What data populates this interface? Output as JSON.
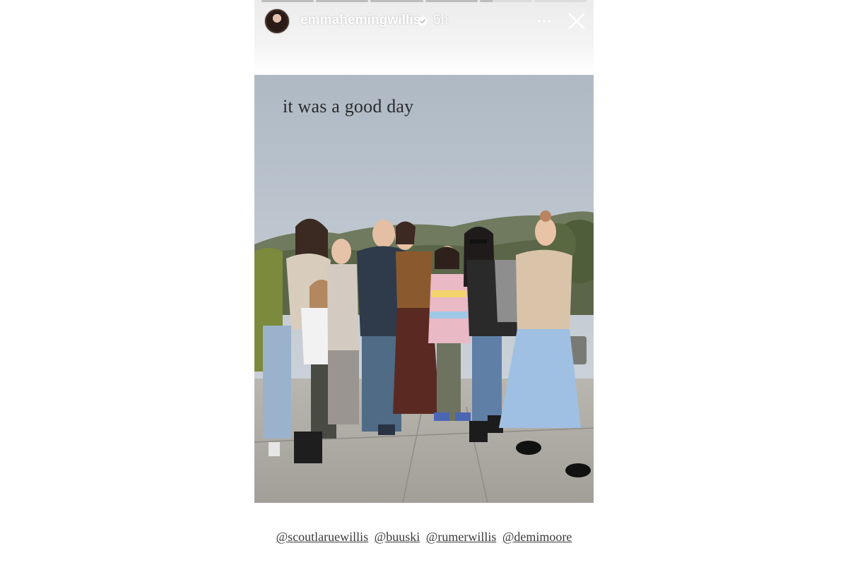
{
  "story": {
    "username": "emmahemingwillis",
    "time_ago": "5h",
    "verified_icon": "verified-badge-icon",
    "more_icon": "more-horizontal-icon",
    "close_icon": "close-icon",
    "segments_total": 6,
    "segment_active_index": 4,
    "segment_active_progress": 0.25
  },
  "photo": {
    "caption": "it was a good day"
  },
  "mentions": [
    "@scoutlaruewillis",
    "@buuski",
    "@rumerwillis",
    "@demimoore"
  ],
  "colors": {
    "sky": "#b9c3cc",
    "text_dark": "#2b2b2b",
    "header_bg": "#ececec"
  }
}
